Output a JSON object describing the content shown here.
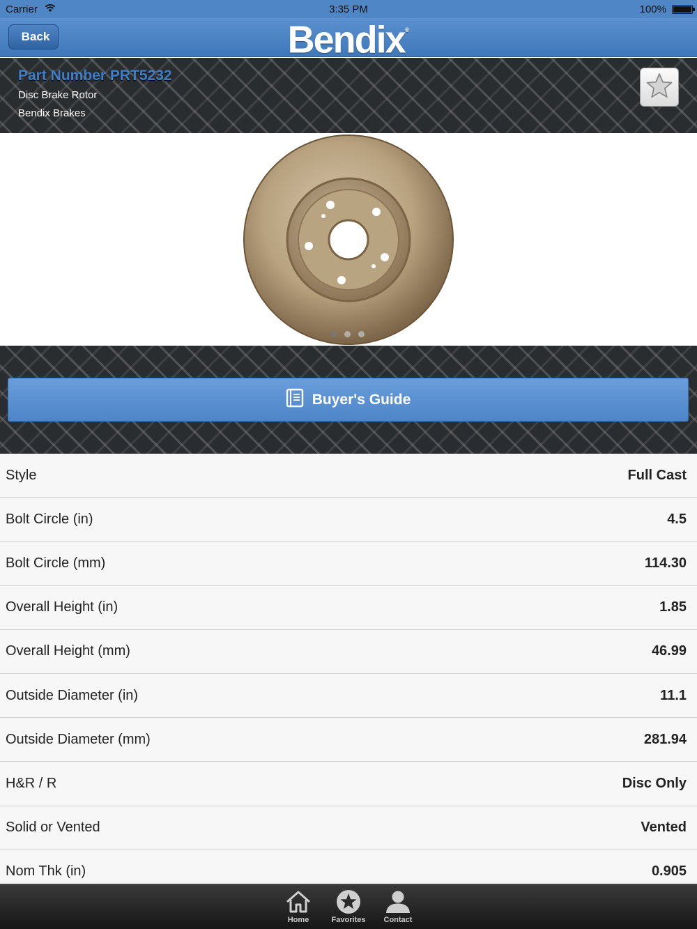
{
  "status_bar": {
    "carrier": "Carrier",
    "time": "3:35 PM",
    "battery": "100%"
  },
  "nav": {
    "back_label": "Back",
    "logo": "Bendix",
    "logo_mark": "®"
  },
  "part": {
    "number": "Part Number PRT5232",
    "description": "Disc Brake Rotor",
    "brand": "Bendix Brakes",
    "favorite_icon": "star-icon"
  },
  "gallery": {
    "page_count": 3,
    "current_page": 1
  },
  "buyers_guide": {
    "label": "Buyer's Guide",
    "icon": "book-icon"
  },
  "specs": [
    {
      "label": "Style",
      "value": "Full Cast"
    },
    {
      "label": "Bolt Circle (in)",
      "value": "4.5"
    },
    {
      "label": "Bolt Circle (mm)",
      "value": "114.30"
    },
    {
      "label": "Overall Height (in)",
      "value": "1.85"
    },
    {
      "label": "Overall Height (mm)",
      "value": "46.99"
    },
    {
      "label": "Outside Diameter (in)",
      "value": "11.1"
    },
    {
      "label": "Outside Diameter (mm)",
      "value": "281.94"
    },
    {
      "label": "H&R / R",
      "value": "Disc Only"
    },
    {
      "label": "Solid or Vented",
      "value": "Vented"
    },
    {
      "label": "Nom Thk (in)",
      "value": "0.905"
    }
  ],
  "tabs": [
    {
      "label": "Home",
      "icon": "home-icon"
    },
    {
      "label": "Favorites",
      "icon": "star-icon"
    },
    {
      "label": "Contact",
      "icon": "person-icon"
    }
  ],
  "colors": {
    "nav_blue": "#4f86c6",
    "part_number_blue": "#3e7fc8",
    "button_blue": "#5a92d2",
    "tab_bar": "#1f1f1f"
  }
}
